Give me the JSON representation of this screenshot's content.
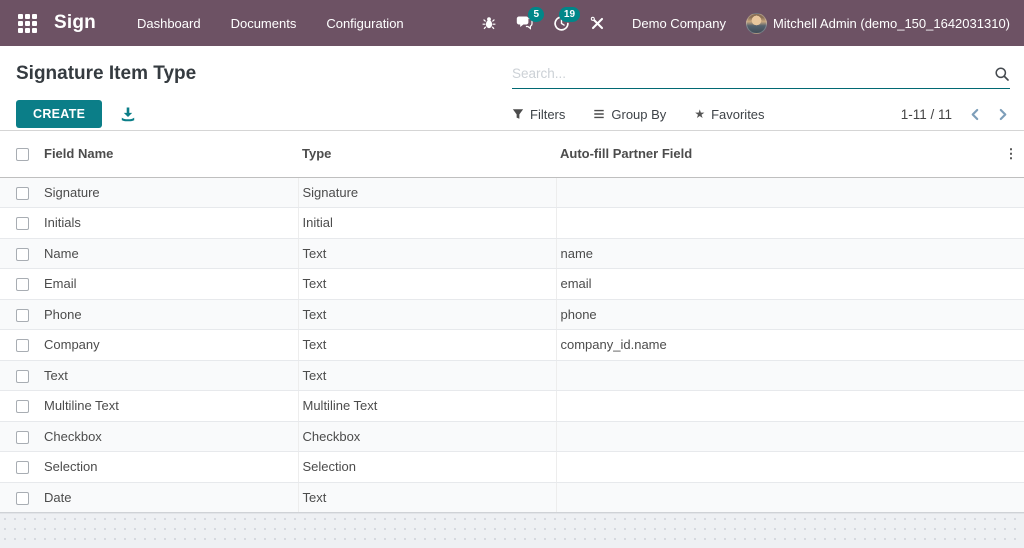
{
  "navbar": {
    "app_name": "Sign",
    "menu": [
      "Dashboard",
      "Documents",
      "Configuration"
    ],
    "systray": {
      "messages_badge": "5",
      "activities_badge": "19",
      "company": "Demo Company",
      "user": "Mitchell Admin (demo_150_1642031310)"
    }
  },
  "control_panel": {
    "title": "Signature Item Type",
    "create_label": "CREATE",
    "search_placeholder": "Search...",
    "filters_label": "Filters",
    "group_by_label": "Group By",
    "favorites_label": "Favorites",
    "pager": {
      "value": "1-11 / 11"
    }
  },
  "table": {
    "columns": [
      "Field Name",
      "Type",
      "Auto-fill Partner Field"
    ],
    "rows": [
      {
        "field_name": "Signature",
        "type": "Signature",
        "autofill": ""
      },
      {
        "field_name": "Initials",
        "type": "Initial",
        "autofill": ""
      },
      {
        "field_name": "Name",
        "type": "Text",
        "autofill": "name"
      },
      {
        "field_name": "Email",
        "type": "Text",
        "autofill": "email"
      },
      {
        "field_name": "Phone",
        "type": "Text",
        "autofill": "phone"
      },
      {
        "field_name": "Company",
        "type": "Text",
        "autofill": "company_id.name"
      },
      {
        "field_name": "Text",
        "type": "Text",
        "autofill": ""
      },
      {
        "field_name": "Multiline Text",
        "type": "Multiline Text",
        "autofill": ""
      },
      {
        "field_name": "Checkbox",
        "type": "Checkbox",
        "autofill": ""
      },
      {
        "field_name": "Selection",
        "type": "Selection",
        "autofill": ""
      },
      {
        "field_name": "Date",
        "type": "Text",
        "autofill": ""
      }
    ]
  },
  "colors": {
    "navbar_bg": "#6d5264",
    "primary_teal": "#0b7e88",
    "badge_teal": "#008789",
    "search_underline": "#016973",
    "pager_arrow": "#7d9eb9"
  }
}
